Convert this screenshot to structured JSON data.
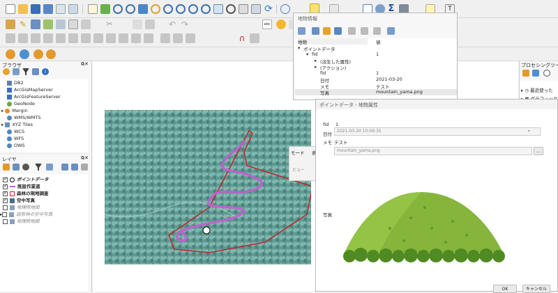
{
  "browser": {
    "title": "ブラウザ",
    "items": [
      "DB2",
      "ArcGisMapServer",
      "ArcGisFeatureServer",
      "GeoNode",
      "Mergin",
      "WMS/WMTS",
      "XYZ Tiles",
      "WCS",
      "WFS",
      "OWS"
    ]
  },
  "layers": {
    "title": "レイヤ",
    "items": [
      {
        "label": "ポイントデータ",
        "checked": true,
        "style": "bold-italic"
      },
      {
        "label": "既設作業道",
        "checked": true,
        "style": "bold"
      },
      {
        "label": "森林の現地調査",
        "checked": true,
        "style": "bold"
      },
      {
        "label": "空中写真",
        "checked": true,
        "style": "bold"
      },
      {
        "label": "地理院地図",
        "checked": false,
        "style": "italic"
      },
      {
        "label": "国有林の空中写真",
        "checked": false,
        "style": "italic"
      },
      {
        "label": "地理院地図",
        "checked": false,
        "style": "italic"
      }
    ]
  },
  "identify": {
    "title": "地物情報",
    "header_feature": "地物",
    "header_value": "値",
    "rows": [
      {
        "indent": 0,
        "arrow": "▾",
        "label": "ポイントデータ",
        "value": ""
      },
      {
        "indent": 1,
        "arrow": "▾",
        "label": "fid",
        "value": "1"
      },
      {
        "indent": 2,
        "arrow": "▸",
        "label": "(派生した属性)",
        "value": ""
      },
      {
        "indent": 2,
        "arrow": "▸",
        "label": "(アクション)",
        "value": ""
      },
      {
        "indent": 2,
        "arrow": "",
        "label": "fid",
        "value": "1"
      },
      {
        "indent": 2,
        "arrow": "",
        "label": "日付",
        "value": "2021-03-20"
      },
      {
        "indent": 2,
        "arrow": "",
        "label": "メモ",
        "value": "テスト"
      },
      {
        "indent": 2,
        "arrow": "",
        "label": "写真",
        "value": "mountain_yama.png"
      }
    ]
  },
  "attr_form": {
    "title": "ポイントデータ - 地物属性",
    "fid_label": "fid",
    "fid_value": "1",
    "date_label": "日付",
    "date_value": "2021-03-20 10:09:35",
    "memo_label": "メモ",
    "memo_value": "テスト",
    "photo_path": "mountain_yama.png",
    "photo_label": "写真",
    "browse_label": "...",
    "ok_label": "OK",
    "cancel_label": "キャンセル"
  },
  "processing": {
    "title": "プロセシングツールボックス",
    "items": [
      "最近使った",
      "グラフィックス"
    ]
  },
  "middle_tabs": {
    "mode_label": "モード",
    "tab_label": "表",
    "view_label": "ビュー"
  }
}
